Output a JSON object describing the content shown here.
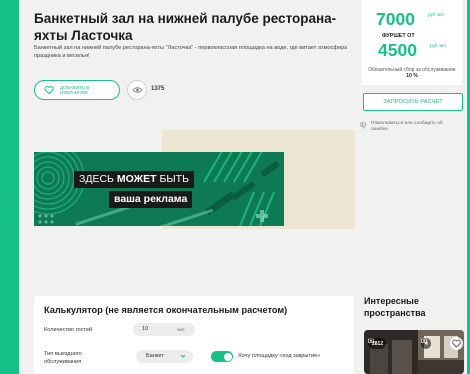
{
  "listing": {
    "title": "Банкетный зал на нижней палубе ресторана-яхты Ласточка",
    "description": "Банкетный зал на нижней палубе ресторана-яхты \"Ласточка\" - первоклассная площадка на воде, где витает атмосфера праздника и веселья!",
    "favorite_label": "ДОБАВИТЬ В ИЗБРАННОЕ",
    "views_count": "1375"
  },
  "ad": {
    "line1_prefix": "ЗДЕСЬ",
    "line1_bold": "МОЖЕТ",
    "line1_suffix": "БЫТЬ",
    "line2": "ваша реклама"
  },
  "calculator": {
    "title": "Калькулятор (не является окончательным расчетом)",
    "guests_label": "Количество гостей",
    "guests_value": "10",
    "guests_unit": "чел.",
    "type_label": "Тип выездного обслуживания",
    "type_value": "Банкет",
    "toggle_label": "Хочу площадку «под закрытие»",
    "toggle_on": true
  },
  "pricing": {
    "price1": "7000",
    "unit1": "руб чел",
    "furshet_label": "ФУРШЕТ ОТ",
    "price2": "4500",
    "unit2": "руб чел",
    "fee_text": "Обязательный сбор за обслуживание",
    "fee_value": "10 %",
    "request_button": "ЗАПРОСИТЬ РАСЧЕТ",
    "complain_text": "Пожаловаться или сообщить об ошибке"
  },
  "sidebar": {
    "interesting_title": "Интересные пространства",
    "cards": [
      {
        "photo_count": "2812"
      },
      {
        "photo_count": "4"
      }
    ]
  },
  "colors": {
    "accent": "#16c187",
    "ad_green": "#0e7a55",
    "beige": "#ede6d3",
    "page_bg": "#f1f1ef"
  }
}
